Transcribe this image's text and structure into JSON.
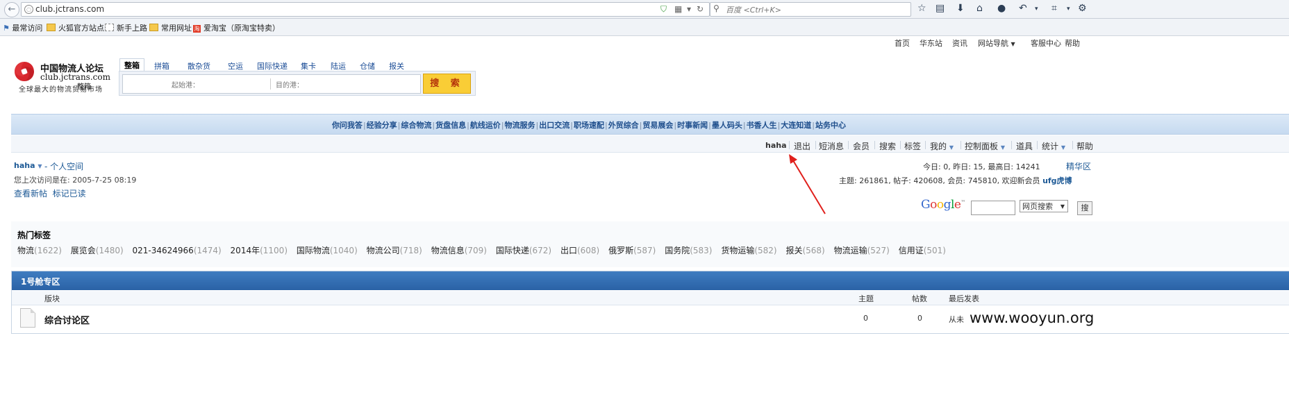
{
  "browser": {
    "url": "club.jctrans.com",
    "search_placeholder": "百度 <Ctrl+K>",
    "bookmarks": [
      "最常访问",
      "火狐官方站点",
      "新手上路",
      "常用网址",
      "爱淘宝（原淘宝特卖）"
    ]
  },
  "topnav": [
    "首页",
    "华东站",
    "资讯",
    "网站导航",
    "客服中心",
    "帮助"
  ],
  "logo": {
    "name": "中国物流人论坛",
    "url": "club.jctrans.com",
    "slogan": "全球最大的物流贸易市场",
    "dropdown": "整箱"
  },
  "search": {
    "tabs": [
      "整箱",
      "拼箱",
      "散杂货",
      "空运",
      "国际快递",
      "集卡",
      "陆运",
      "仓储",
      "报关"
    ],
    "origin_placeholder": "起始港：",
    "dest_placeholder": "目的港：",
    "button": "搜 索"
  },
  "categories": [
    "你问我答",
    "经验分享",
    "综合物流",
    "货盘信息",
    "航线运价",
    "物流服务",
    "出口交流",
    "职场速配",
    "外贸综合",
    "贸易展会",
    "时事新闻",
    "墨人码头",
    "书香人生",
    "大连知道",
    "站务中心"
  ],
  "userbar": {
    "username": "haha",
    "items": [
      "退出",
      "短消息",
      "会员",
      "搜索",
      "标签",
      "我的",
      "控制面板",
      "道具",
      "统计",
      "帮助"
    ]
  },
  "welcome": {
    "username": "haha",
    "space": "- 个人空间",
    "last_visit": "您上次访问是在: 2005-7-25 08:19",
    "new_posts": "查看新帖",
    "mark_read": "标记已读"
  },
  "stats": {
    "line1": "今日: 0, 昨日: 15, 最高日: 14241",
    "jinghua": "精华区",
    "line2": "主题: 261861, 帖子: 420608, 会员: 745810, 欢迎新会员",
    "new_member": "ufg虎博"
  },
  "google": {
    "logo": "Google",
    "select": "网页搜索",
    "button": "搜"
  },
  "hot_tags": {
    "title": "热门标签",
    "tags": [
      {
        "name": "物流",
        "count": "(1622)"
      },
      {
        "name": "展览会",
        "count": "(1480)"
      },
      {
        "name": "021-34624966",
        "count": "(1474)"
      },
      {
        "name": "2014年",
        "count": "(1100)"
      },
      {
        "name": "国际物流",
        "count": "(1040)"
      },
      {
        "name": "物流公司",
        "count": "(718)"
      },
      {
        "name": "物流信息",
        "count": "(709)"
      },
      {
        "name": "国际快递",
        "count": "(672)"
      },
      {
        "name": "出口",
        "count": "(608)"
      },
      {
        "name": "俄罗斯",
        "count": "(587)"
      },
      {
        "name": "国务院",
        "count": "(583)"
      },
      {
        "name": "货物运输",
        "count": "(582)"
      },
      {
        "name": "报关",
        "count": "(568)"
      },
      {
        "name": "物流运输",
        "count": "(527)"
      },
      {
        "name": "信用证",
        "count": "(501)"
      }
    ]
  },
  "forum": {
    "title": "1号舱专区",
    "col_board": "版块",
    "col_topics": "主题",
    "col_posts": "帖数",
    "col_last": "最后发表",
    "row_name": "综合讨论区",
    "row_topics": "0",
    "row_posts": "0",
    "row_last": "从未"
  },
  "watermark": "www.wooyun.org",
  "colors": {
    "accent": "#1e5a96",
    "search_button": "#f9cd36",
    "forum_header": "#2a62a6",
    "arrow": "#e0201c"
  }
}
